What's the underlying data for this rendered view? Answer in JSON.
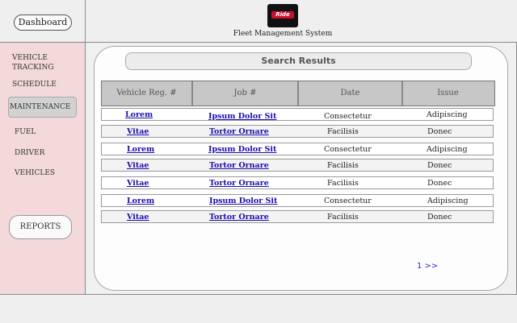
{
  "header": {
    "dashboard_label": "Dashboard",
    "app_title": "Fleet Management System",
    "logo_text": "Ride"
  },
  "sidebar": {
    "items": [
      {
        "label": "VEHICLE TRACKING"
      },
      {
        "label": "SCHEDULE"
      },
      {
        "label": "MAINTENANCE",
        "active": true
      },
      {
        "label": "FUEL"
      },
      {
        "label": "DRIVER"
      },
      {
        "label": "VEHICLES"
      }
    ],
    "reports_label": "REPORTS"
  },
  "search": {
    "title": "Search Results"
  },
  "table": {
    "columns": [
      "Vehicle Reg. #",
      "Job #",
      "Date",
      "Issue"
    ],
    "rows": [
      {
        "reg": "Lorem",
        "job": "Ipsum Dolor Sit",
        "date": "Consectetur",
        "issue": "Adipiscing"
      },
      {
        "reg": "Vitae",
        "job": "Tortor Ornare",
        "date": "Facilisis",
        "issue": "Donec"
      },
      {
        "reg": "Lorem",
        "job": "Ipsum Dolor Sit",
        "date": "Consectetur",
        "issue": "Adipiscing"
      },
      {
        "reg": "Vitae",
        "job": "Tortor Ornare",
        "date": "Facilisis",
        "issue": "Donec"
      },
      {
        "reg": "Vitae",
        "job": "Tortor Ornare",
        "date": "Facilisis",
        "issue": "Donec"
      },
      {
        "reg": "Lorem",
        "job": "Ipsum Dolor Sit",
        "date": "Consectetur",
        "issue": "Adipiscing"
      },
      {
        "reg": "Vitae",
        "job": "Tortor Ornare",
        "date": "Facilisis",
        "issue": "Donec"
      }
    ]
  },
  "pagination": {
    "label": "1 >>"
  },
  "colors": {
    "sidebar_bg": "#f4d9db",
    "link": "#1a0dab",
    "pager": "#2b2bd0",
    "logo_accent": "#c8102e"
  }
}
